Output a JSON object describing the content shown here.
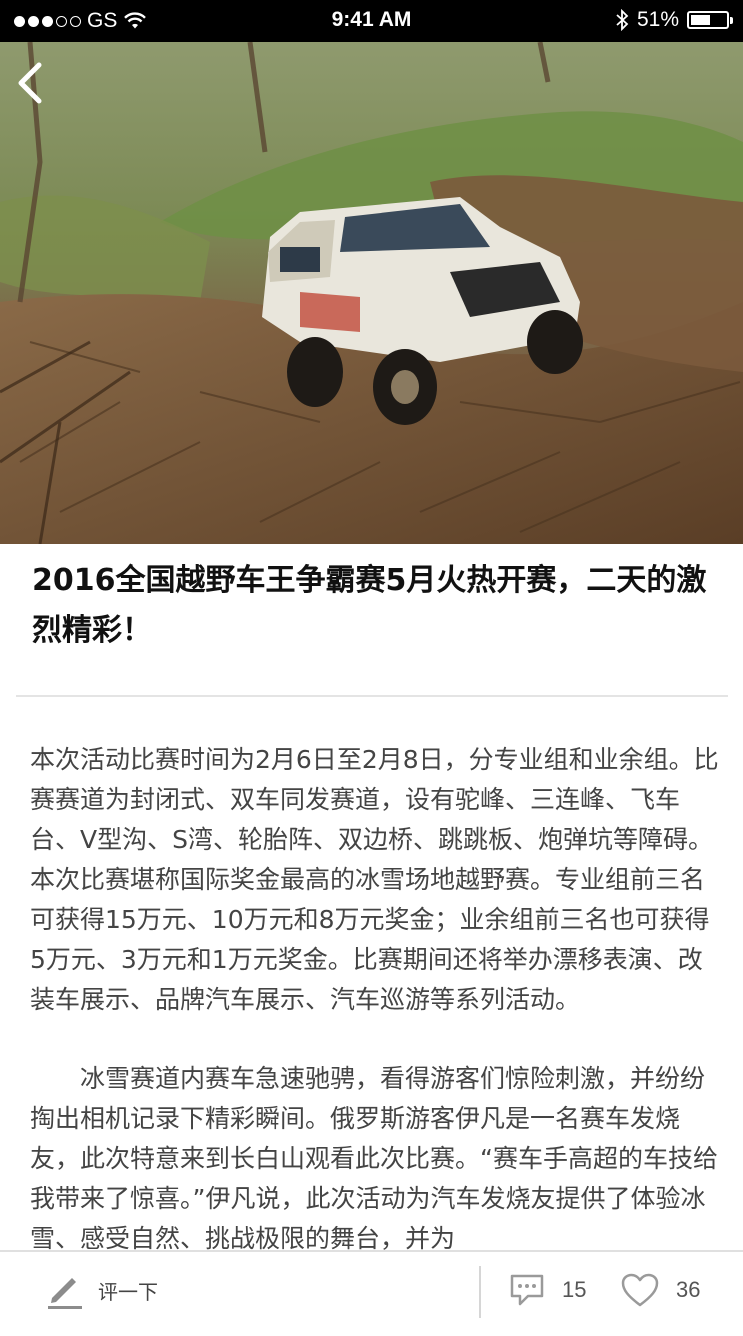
{
  "status_bar": {
    "carrier": "GS",
    "time": "9:41 AM",
    "battery": "51%",
    "signal_bars_filled": 3,
    "signal_bars_total": 5
  },
  "article": {
    "title": "2016全国越野车王争霸赛5月火热开赛，二天的激烈精彩！",
    "paragraphs": [
      "本次活动比赛时间为2月6日至2月8日，分专业组和业余组。比赛赛道为封闭式、双车同发赛道，设有驼峰、三连峰、飞车台、V型沟、S湾、轮胎阵、双边桥、跳跳板、炮弹坑等障碍。本次比赛堪称国际奖金最高的冰雪场地越野赛。专业组前三名可获得15万元、10万元和8万元奖金；业余组前三名也可获得5万元、3万元和1万元奖金。比赛期间还将举办漂移表演、改装车展示、品牌汽车展示、汽车巡游等系列活动。",
      "冰雪赛道内赛车急速驰骋，看得游客们惊险刺激，并纷纷掏出相机记录下精彩瞬间。俄罗斯游客伊凡是一名赛车发烧友，此次特意来到长白山观看此次比赛。“赛车手高超的车技给我带来了惊喜。”伊凡说，此次活动为汽车发烧友提供了体验冰雪、感受自然、挑战极限的舞台，并为"
    ]
  },
  "bottom_bar": {
    "compose_label": "评一下",
    "comment_count": "15",
    "like_count": "36"
  },
  "icons": {
    "back": "chevron-left-icon",
    "compose": "pencil-icon",
    "comments": "speech-bubble-icon",
    "likes": "heart-icon"
  },
  "colors": {
    "status_bar_bg": "#000000",
    "divider": "#e4e4e4",
    "icon_gray": "#9a9a9a"
  }
}
